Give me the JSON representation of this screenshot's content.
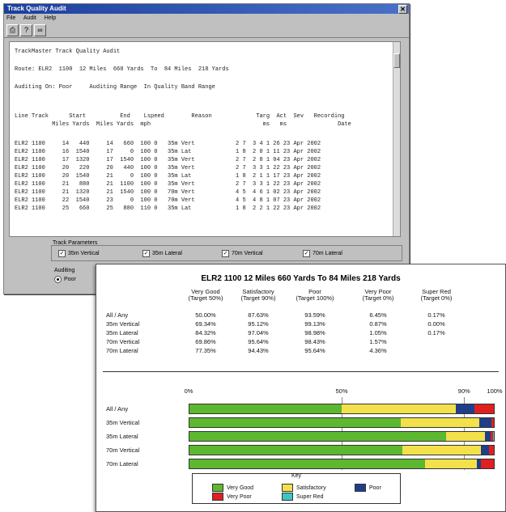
{
  "window": {
    "title": "Track Quality Audit",
    "menu": [
      "File",
      "Audit",
      "Help"
    ],
    "toolbar_icons": [
      "print-icon",
      "help-icon",
      "binoculars-icon"
    ]
  },
  "report": {
    "heading": "TrackMaster Track Quality Audit",
    "route_line": "Route: ELR2  1100  12 Miles  660 Yards  To  84 Miles  218 Yards",
    "audit_line": "Auditing On: Poor     Auditing Range  In Quality Band Range",
    "col1": "Line Track      Start          End    Lspeed        Reason             Targ  Act  Sev   Recording",
    "col2": "           Miles Yards  Miles Yards  mph                                 ms   ms               Date",
    "rows": [
      "ELR2 1100     14   440     14   660  100 0   35m Vert            2 7  3 4 1 26 23 Apr 2002",
      "ELR2 1100     16  1540     17     0  100 0   35m Lat             1 8  2 0 1 11 23 Apr 2002",
      "ELR2 1100     17  1320     17  1540  100 0   35m Vert            2 7  2 8 1 04 23 Apr 2002",
      "ELR2 1100     20   220     20   440  100 0   35m Vert            2 7  3 3 1 22 23 Apr 2002",
      "ELR2 1100     20  1540     21     0  100 0   35m Lat             1 8  2 1 1 17 23 Apr 2002",
      "ELR2 1100     21   880     21  1100  100 0   35m Vert            2 7  3 3 1 22 23 Apr 2002",
      "ELR2 1100     21  1320     21  1540  100 0   70m Vert            4 5  4 6 1 02 23 Apr 2002",
      "ELR2 1100     22  1540     23     0  100 0   70m Vert            4 5  4 8 1 07 23 Apr 2002",
      "ELR2 1100     25   660     25   880  110 0   35m Lat             1 8  2 2 1 22 23 Apr 2002"
    ]
  },
  "track_params": {
    "label": "Track Parameters",
    "items": [
      "35m Vertical",
      "35m Lateral",
      "70m Vertical",
      "70m Lateral"
    ]
  },
  "auditing": {
    "label": "Auditing",
    "option": "Poor"
  },
  "summary": {
    "title": "ELR2  1100  12 Miles  660 Yards  To  84 Miles  218 Yards",
    "columns": [
      {
        "name": "Very Good",
        "target": "(Target 50%)"
      },
      {
        "name": "Satisfactory",
        "target": "(Target 90%)"
      },
      {
        "name": "Poor",
        "target": "(Target 100%)"
      },
      {
        "name": "Very Poor",
        "target": "(Target 0%)"
      },
      {
        "name": "Super Red",
        "target": "(Target 0%)"
      }
    ],
    "rows": [
      {
        "label": "All / Any",
        "values": [
          "50.00%",
          "87.63%",
          "93.59%",
          "6.45%",
          "0.17%"
        ]
      },
      {
        "label": "35m Vertical",
        "values": [
          "69.34%",
          "95.12%",
          "99.13%",
          "0.87%",
          "0.00%"
        ]
      },
      {
        "label": "35m Lateral",
        "values": [
          "84.32%",
          "97.04%",
          "98.98%",
          "1.05%",
          "0.17%"
        ]
      },
      {
        "label": "70m Vertical",
        "values": [
          "69.86%",
          "95.64%",
          "98.43%",
          "1.57%",
          ""
        ]
      },
      {
        "label": "70m Lateral",
        "values": [
          "77.35%",
          "94.43%",
          "95.64%",
          "4.36%",
          ""
        ]
      }
    ]
  },
  "chart_data": {
    "type": "bar",
    "orientation": "horizontal-stacked",
    "x_ticks": [
      "0%",
      "50%",
      "90%",
      "100%"
    ],
    "xlim": [
      0,
      100
    ],
    "categories": [
      "All / Any",
      "35m Vertical",
      "35m Lateral",
      "70m Vertical",
      "70m Lateral"
    ],
    "series": [
      {
        "name": "Very Good",
        "color": "#5cb82e",
        "values": [
          50.0,
          69.34,
          84.32,
          69.86,
          77.35
        ]
      },
      {
        "name": "Satisfactory",
        "color": "#f2e14a",
        "values": [
          37.63,
          25.78,
          12.72,
          25.78,
          17.08
        ]
      },
      {
        "name": "Poor",
        "color": "#1f3f8a",
        "values": [
          5.96,
          4.01,
          1.94,
          2.79,
          1.21
        ]
      },
      {
        "name": "Very Poor",
        "color": "#e02020",
        "values": [
          6.41,
          0.87,
          0.88,
          1.57,
          4.36
        ]
      },
      {
        "name": "Super Red",
        "color": "#3fc4c4",
        "values": [
          0,
          0,
          0.17,
          0,
          0
        ]
      }
    ],
    "legend": {
      "title": "Key",
      "placement": "bottom",
      "items": [
        {
          "name": "Very Good",
          "color": "#5cb82e"
        },
        {
          "name": "Very Poor",
          "color": "#e02020"
        },
        {
          "name": "Satisfactory",
          "color": "#f2e14a"
        },
        {
          "name": "Super Red",
          "color": "#3fc4c4"
        },
        {
          "name": "Poor",
          "color": "#1f3f8a"
        }
      ]
    }
  }
}
